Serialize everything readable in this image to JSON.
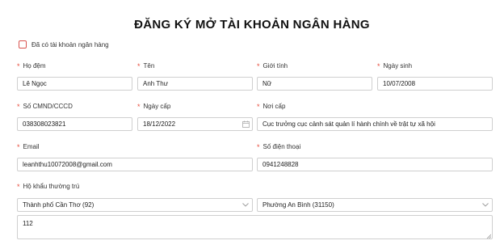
{
  "form": {
    "title": "ĐĂNG KÝ MỞ TÀI KHOẢN NGÂN HÀNG",
    "existing_account_label": "Đã có tài khoản ngân hàng",
    "required_mark": "*",
    "fields": {
      "ho_dem": {
        "label": "Họ đệm",
        "value": "Lê Ngọc"
      },
      "ten": {
        "label": "Tên",
        "value": "Anh Thư"
      },
      "gioi_tinh": {
        "label": "Giới tính",
        "value": "Nữ"
      },
      "ngay_sinh": {
        "label": "Ngày sinh",
        "value": "10/07/2008"
      },
      "so_cmnd": {
        "label": "Số CMND/CCCD",
        "value": "038308023821"
      },
      "ngay_cap": {
        "label": "Ngày cấp",
        "value": "18/12/2022"
      },
      "noi_cap": {
        "label": "Nơi cấp",
        "value": "Cục trưởng cục cảnh sát quản lí hành chính về trật tự xã hội"
      },
      "email": {
        "label": "Email",
        "value": "leanhthu10072008@gmail.com"
      },
      "so_dien_thoai": {
        "label": "Số điện thoại",
        "value": "0941248828"
      },
      "ho_khau": {
        "label": "Hộ khẩu thường trú",
        "province": "Thành phố Cần Thơ (92)",
        "ward": "Phường An Bình (31150)",
        "address": "112"
      }
    }
  },
  "icons": {
    "calendar": "calendar-icon",
    "dropdown": "chevron-down-icon",
    "resize": "resize-handle-icon"
  },
  "colors": {
    "required": "#e74c3c",
    "checkbox_border": "#d9534f",
    "input_border": "#cfcfcf"
  }
}
